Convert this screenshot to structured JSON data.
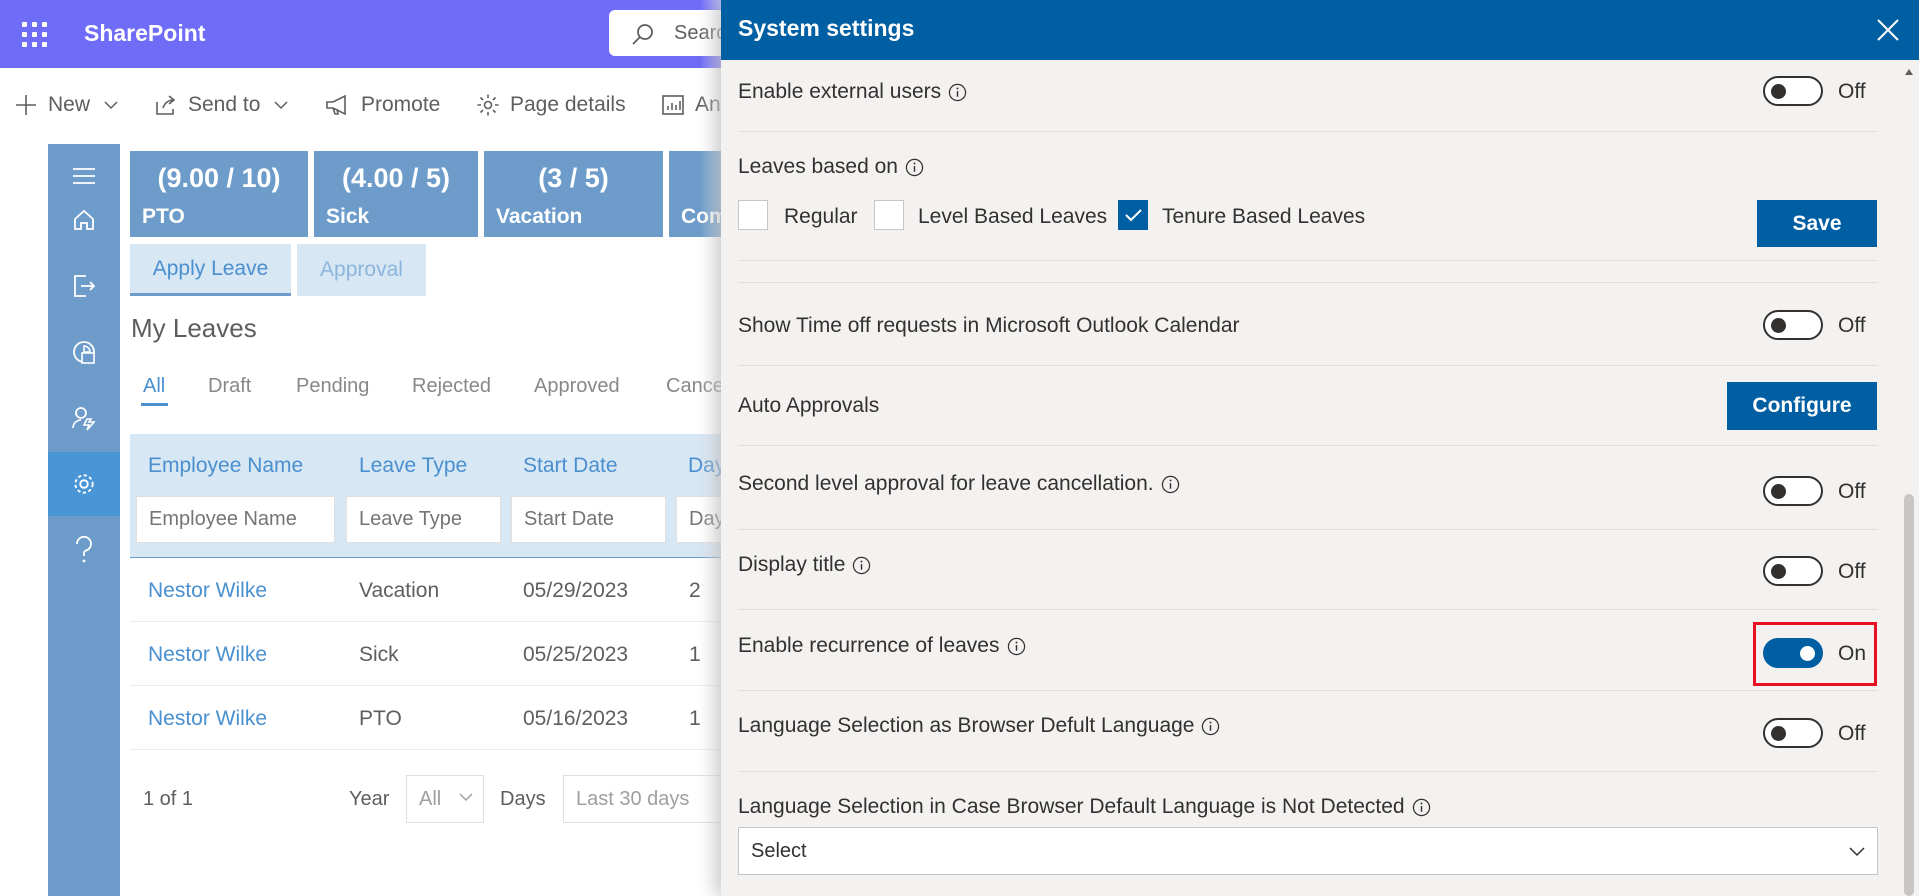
{
  "suite_bar": {
    "app_name": "SharePoint",
    "search_placeholder": "Search",
    "search_value": "Searc"
  },
  "command_bar": {
    "items": [
      {
        "label": "New",
        "icon": "plus-icon",
        "has_dropdown": true
      },
      {
        "label": "Send to",
        "icon": "share-icon",
        "has_dropdown": true
      },
      {
        "label": "Promote",
        "icon": "megaphone-icon"
      },
      {
        "label": "Page details",
        "icon": "gear-icon"
      },
      {
        "label": "An",
        "icon": "analytics-icon"
      }
    ]
  },
  "nav_rail": {
    "items": [
      {
        "name": "menu",
        "icon": "hamburger-icon"
      },
      {
        "name": "home",
        "icon": "home-icon"
      },
      {
        "name": "apply-leave",
        "icon": "sign-out-icon"
      },
      {
        "name": "reports",
        "icon": "report-icon"
      },
      {
        "name": "manage-users",
        "icon": "user-settings-icon"
      },
      {
        "name": "settings",
        "icon": "gear-icon",
        "active": true
      },
      {
        "name": "help",
        "icon": "question-icon"
      }
    ]
  },
  "balance_tiles": [
    {
      "value": "(9.00 / 10)",
      "name": "PTO"
    },
    {
      "value": "(4.00 / 5)",
      "name": "Sick"
    },
    {
      "value": "(3 / 5)",
      "name": "Vacation"
    },
    {
      "value": "",
      "name": "Com"
    }
  ],
  "tabs": {
    "apply_leave": "Apply Leave",
    "approval": "Approval"
  },
  "my_leaves": {
    "title": "My Leaves",
    "pivots": [
      "All",
      "Draft",
      "Pending",
      "Rejected",
      "Approved",
      "Cance"
    ],
    "selected_pivot": "All",
    "columns": [
      "Employee Name",
      "Leave Type",
      "Start Date",
      "Day"
    ],
    "filter_placeholders": [
      "Employee Name",
      "Leave Type",
      "Start Date",
      "Day"
    ],
    "rows": [
      {
        "employee": "Nestor Wilke",
        "type": "Vacation",
        "start": "05/29/2023",
        "days": "2"
      },
      {
        "employee": "Nestor Wilke",
        "type": "Sick",
        "start": "05/25/2023",
        "days": "1"
      },
      {
        "employee": "Nestor Wilke",
        "type": "PTO",
        "start": "05/16/2023",
        "days": "1"
      }
    ],
    "pager": "1 of 1",
    "year_label": "Year",
    "year_value": "All",
    "days_label": "Days",
    "days_value": "Last 30 days"
  },
  "settings_panel": {
    "title": "System settings",
    "external_users": {
      "label": "Enable external users",
      "state": "Off",
      "on": false
    },
    "leaves_based_on": {
      "label": "Leaves based on",
      "options": [
        {
          "label": "Regular",
          "checked": false
        },
        {
          "label": "Level Based Leaves",
          "checked": false
        },
        {
          "label": "Tenure Based Leaves",
          "checked": true
        }
      ],
      "save_label": "Save"
    },
    "outlook_calendar": {
      "label": "Show Time off requests in Microsoft Outlook Calendar",
      "state": "Off",
      "on": false
    },
    "auto_approvals": {
      "label": "Auto Approvals",
      "button_label": "Configure"
    },
    "second_level_approval": {
      "label": "Second level approval for leave cancellation.",
      "state": "Off",
      "on": false
    },
    "display_title": {
      "label": "Display title",
      "state": "Off",
      "on": false
    },
    "recurrence": {
      "label": "Enable recurrence of leaves",
      "state": "On",
      "on": true
    },
    "browser_language": {
      "label": "Language Selection as Browser Defult Language",
      "state": "Off",
      "on": false
    },
    "fallback_language": {
      "label": "Language Selection in Case Browser Default Language is Not Detected",
      "select_value": "Select"
    }
  },
  "colors": {
    "suite_bar": "#6f6cf7",
    "panel_header": "#005ea2",
    "accent": "#005ea2",
    "rail": "#6d9ccb",
    "highlight": "#e81123"
  }
}
